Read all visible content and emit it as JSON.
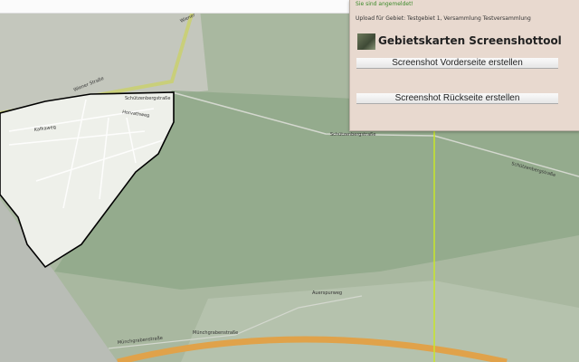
{
  "panel": {
    "status": "Sie sind angemeldet!",
    "upload_info": "Upload für Gebiet: Testgebiet 1, Versammlung Testversammlung",
    "title": "Gebietskarten Screenshottool",
    "front_button": "Screenshot Vorderseite erstellen",
    "back_button": "Screenshot Rückseite erstellen"
  },
  "map": {
    "streets": {
      "wiener1": "Wiener Straße",
      "wiener2": "Wiener",
      "schuetzen1": "Schützenbergstraße",
      "schuetzen2": "Schützenbergstraße",
      "schuetzen3": "Schützenbergstraße",
      "horvath": "Horvathweg",
      "kafka": "Kafkaweg",
      "muench": "Münchgrabenstraße",
      "muench2": "Münchgrabenstraße",
      "ausp": "Auerspurweg"
    },
    "colors": {
      "area_outline": "#000000",
      "marker_line": "#c8e62a",
      "motorway": "#e0a24a"
    }
  }
}
